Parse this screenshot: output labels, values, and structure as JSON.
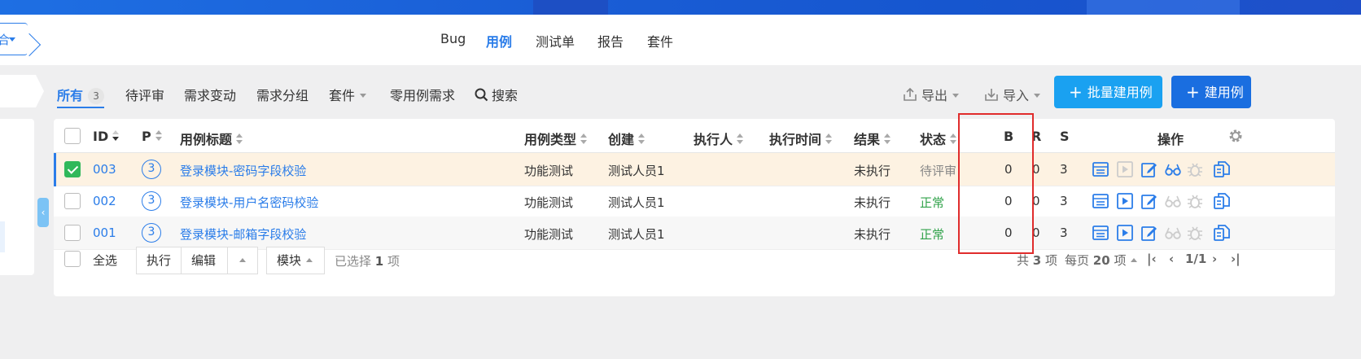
{
  "breadcrumb": {
    "text": "合"
  },
  "subnav": {
    "items": [
      "Bug",
      "用例",
      "测试单",
      "报告",
      "套件"
    ],
    "active_index": 1
  },
  "filters": {
    "all": {
      "label": "所有",
      "count": "3"
    },
    "items": [
      "待评审",
      "需求变动",
      "需求分组",
      "套件",
      "零用例需求"
    ],
    "search": "搜索"
  },
  "toolbar": {
    "export": "导出",
    "import": "导入",
    "batch_create": "批量建用例",
    "create": "建用例"
  },
  "table": {
    "headers": {
      "id": "ID",
      "p": "P",
      "title": "用例标题",
      "type": "用例类型",
      "creator": "创建",
      "executor": "执行人",
      "exec_time": "执行时间",
      "result": "结果",
      "status": "状态",
      "b": "B",
      "r": "R",
      "s": "S",
      "actions": "操作"
    },
    "rows": [
      {
        "id": "003",
        "p": "3",
        "title": "登录模块-密码字段校验",
        "type": "功能测试",
        "creator": "测试人员1",
        "executor": "",
        "exec_time": "",
        "result": "未执行",
        "status": "待评审",
        "b": "0",
        "r": "0",
        "s": "3"
      },
      {
        "id": "002",
        "p": "3",
        "title": "登录模块-用户名密码校验",
        "type": "功能测试",
        "creator": "测试人员1",
        "executor": "",
        "exec_time": "",
        "result": "未执行",
        "status": "正常",
        "b": "0",
        "r": "0",
        "s": "3"
      },
      {
        "id": "001",
        "p": "3",
        "title": "登录模块-邮箱字段校验",
        "type": "功能测试",
        "creator": "测试人员1",
        "executor": "",
        "exec_time": "",
        "result": "未执行",
        "status": "正常",
        "b": "0",
        "r": "0",
        "s": "3"
      }
    ]
  },
  "footer": {
    "select_all": "全选",
    "execute": "执行",
    "edit": "编辑",
    "module": "模块",
    "selected_text": "已选择",
    "selected_count": "1",
    "selected_unit": "项",
    "total_prefix": "共",
    "total_count": "3",
    "total_unit": "项",
    "per_page_prefix": "每页",
    "per_page": "20",
    "per_page_unit": "项",
    "page": "1/1"
  },
  "colors": {
    "accent": "#2b7de9",
    "primary_button_light": "#1aa1f1",
    "primary_button": "#1a6ee0",
    "status_ok": "#30a24a",
    "highlight_box": "#e02c2c"
  },
  "icons": [
    "chevron-down-icon",
    "search-icon",
    "export-icon",
    "import-icon",
    "plus-icon",
    "list-icon",
    "play-icon",
    "edit-icon",
    "glasses-icon",
    "bug-icon",
    "copy-icon",
    "gear-icon",
    "first-page-icon",
    "prev-page-icon",
    "next-page-icon",
    "last-page-icon"
  ]
}
